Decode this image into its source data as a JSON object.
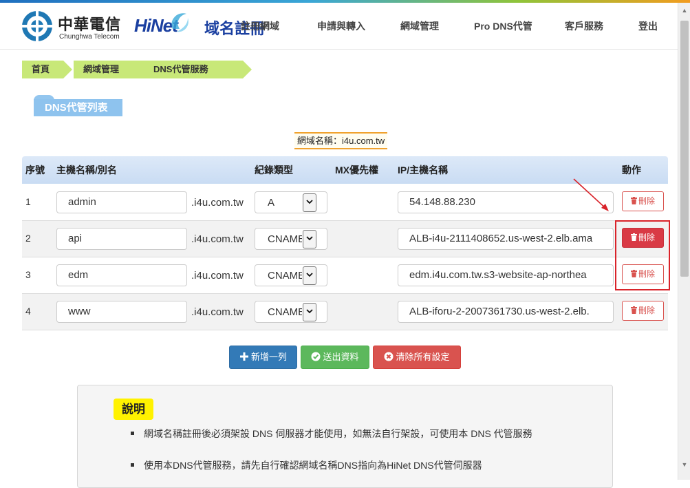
{
  "brand": {
    "cht_name": "中華電信",
    "cht_en": "Chunghwa Telecom",
    "hinet": "HiNet",
    "hinet_sub": "域名註冊"
  },
  "nav": [
    "註冊網域",
    "申請與轉入",
    "網域管理",
    "Pro DNS代管",
    "客戶服務",
    "登出"
  ],
  "breadcrumb": [
    "首頁",
    "網域管理",
    "DNS代管服務"
  ],
  "section_title": "DNS代管列表",
  "domain_label": "網域名稱：i4u.com.tw",
  "table": {
    "headers": {
      "seq": "序號",
      "host": "主機名稱/別名",
      "type": "紀錄類型",
      "mx": "MX優先權",
      "ip": "IP/主機名稱",
      "action": "動作"
    },
    "rows": [
      {
        "seq": "1",
        "host": "admin",
        "suffix": ".i4u.com.tw",
        "type": "A",
        "ip": "54.148.88.230",
        "delete": "刪除"
      },
      {
        "seq": "2",
        "host": "api",
        "suffix": ".i4u.com.tw",
        "type": "CNAME",
        "ip": "ALB-i4u-2111408652.us-west-2.elb.ama",
        "delete": "刪除"
      },
      {
        "seq": "3",
        "host": "edm",
        "suffix": ".i4u.com.tw",
        "type": "CNAME",
        "ip": "edm.i4u.com.tw.s3-website-ap-northea",
        "delete": "刪除"
      },
      {
        "seq": "4",
        "host": "www",
        "suffix": ".i4u.com.tw",
        "type": "CNAME",
        "ip": "ALB-iforu-2-2007361730.us-west-2.elb.",
        "delete": "刪除"
      }
    ]
  },
  "buttons": {
    "add": "新增一列",
    "send": "送出資料",
    "clear": "清除所有設定"
  },
  "notes": {
    "title": "說明",
    "items": [
      "網域名稱註冊後必須架設 DNS 伺服器才能使用，如無法自行架設，可使用本 DNS 代管服務",
      "使用本DNS代管服務，請先自行確認網域名稱DNS指向為HiNet DNS代管伺服器"
    ]
  },
  "colors": {
    "breadcrumb": "#c8e878",
    "section_tag": "#8ec3ee",
    "primary": "#337ab7",
    "success": "#5cb85c",
    "danger": "#d9534f",
    "highlight": "#d9232a"
  },
  "icons": {
    "delete": "trash-icon",
    "add": "plus-icon",
    "send": "check-circle-icon",
    "clear": "times-circle-icon"
  }
}
